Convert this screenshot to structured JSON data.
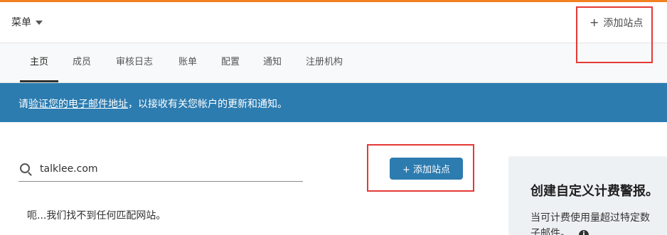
{
  "header": {
    "menu_label": "菜单",
    "add_site_label": "添加站点"
  },
  "tabs": [
    {
      "label": "主页",
      "active": true
    },
    {
      "label": "成员"
    },
    {
      "label": "审核日志"
    },
    {
      "label": "账单"
    },
    {
      "label": "配置"
    },
    {
      "label": "通知"
    },
    {
      "label": "注册机构"
    }
  ],
  "banner": {
    "prefix": "请",
    "link_text": "验证您的电子邮件地址",
    "suffix": "，以接收有关您帐户的更新和通知。"
  },
  "search": {
    "value": "talklee.com",
    "placeholder": ""
  },
  "main": {
    "add_site_button": "+ 添加站点",
    "empty_message": "呃...我们找不到任何匹配网站。"
  },
  "side_card": {
    "title": "创建自定义计费警报。",
    "description_line1": "当可计费使用量超过特定数",
    "description_line2": "子邮件。"
  },
  "colors": {
    "accent_orange": "#f38020",
    "primary_blue": "#2c7cb0",
    "highlight_red": "#e53935"
  },
  "icons": [
    "caret-down-icon",
    "plus-icon",
    "search-icon",
    "info-icon"
  ]
}
